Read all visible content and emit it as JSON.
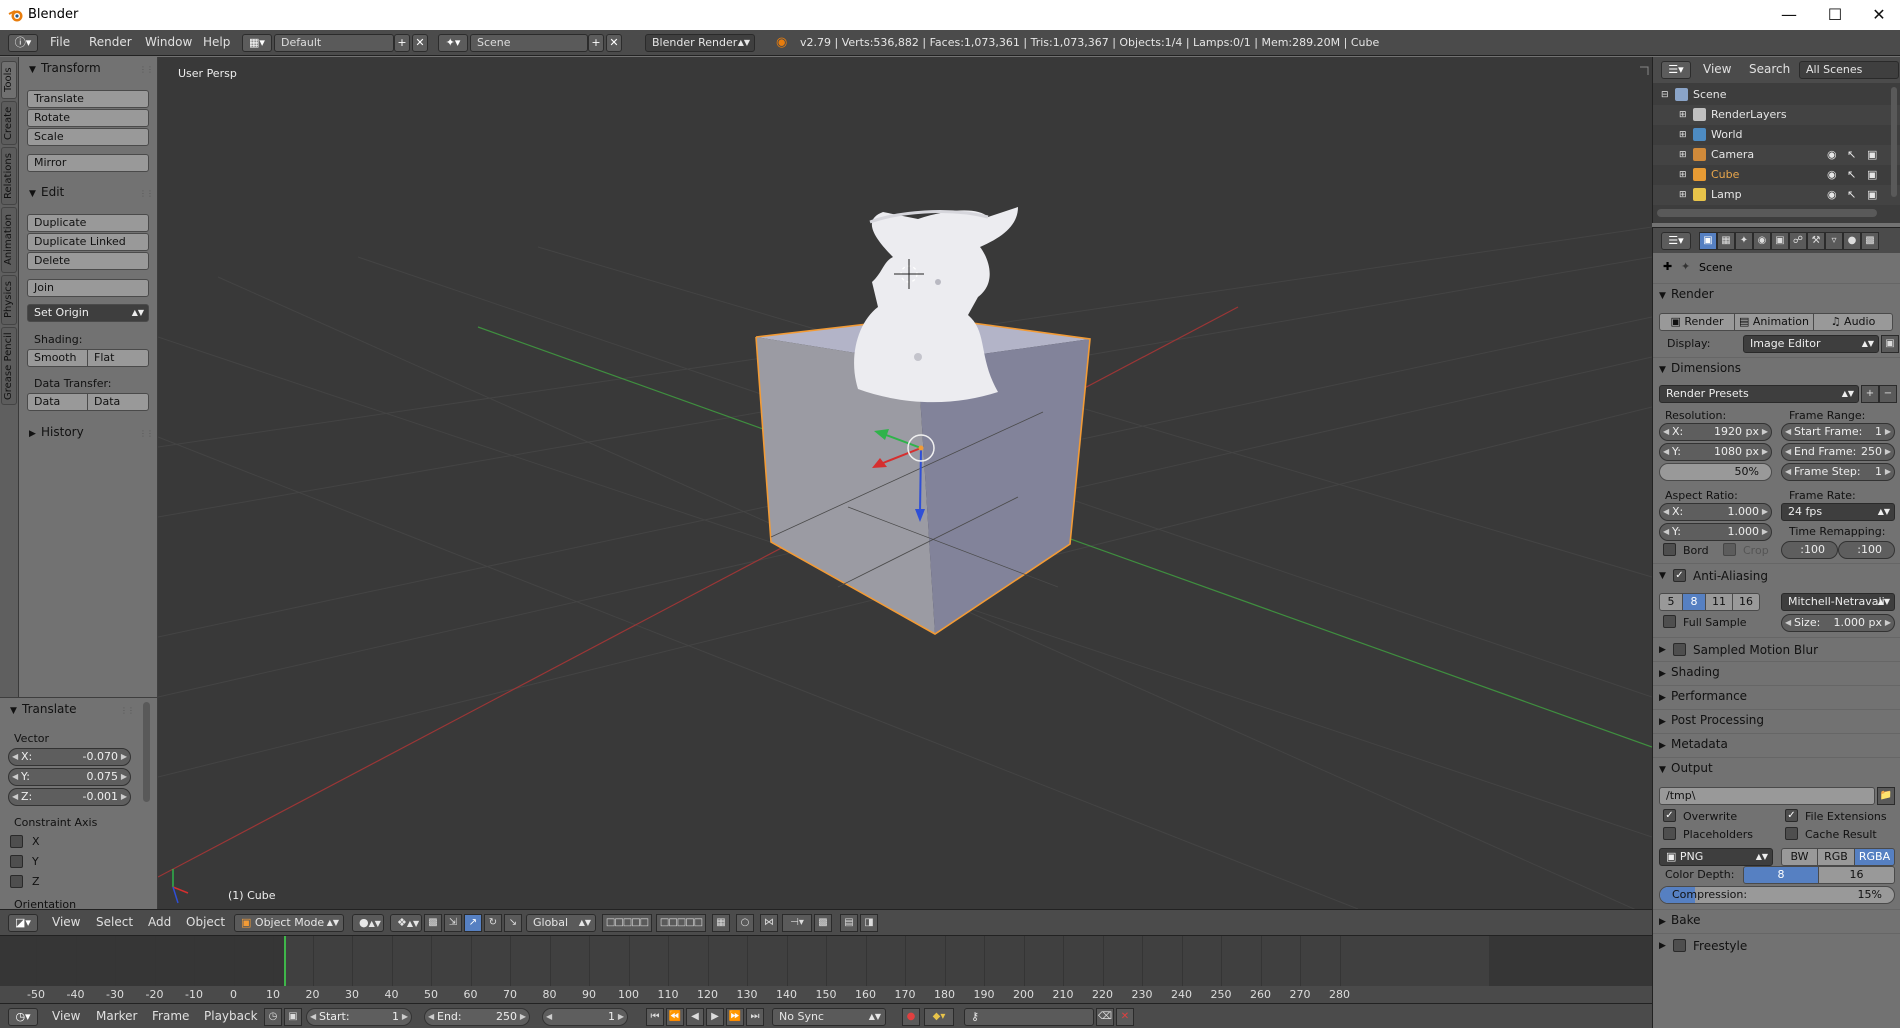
{
  "window": {
    "title": "Blender"
  },
  "info_header": {
    "menus": [
      "File",
      "Render",
      "Window",
      "Help"
    ],
    "screen_layout": "Default",
    "scene": "Scene",
    "render_engine": "Blender Render",
    "stats": "v2.79 | Verts:536,882 | Faces:1,073,361 | Tris:1,073,367 | Objects:1/4 | Lamps:0/1 | Mem:289.20M | Cube"
  },
  "tool_tabs": [
    "Tools",
    "Create",
    "Relations",
    "Animation",
    "Physics",
    "Grease Pencil"
  ],
  "toolshelf": {
    "transform": {
      "title": "Transform",
      "buttons": [
        "Translate",
        "Rotate",
        "Scale",
        "Mirror"
      ]
    },
    "edit": {
      "title": "Edit",
      "buttons": [
        "Duplicate",
        "Duplicate Linked",
        "Delete",
        "Join"
      ],
      "set_origin": "Set Origin",
      "shading_label": "Shading:",
      "smooth": "Smooth",
      "flat": "Flat",
      "data_transfer_label": "Data Transfer:",
      "data": "Data",
      "data_layout": "Data Layo"
    },
    "history": {
      "title": "History"
    }
  },
  "redo_panel": {
    "title": "Translate",
    "vector_label": "Vector",
    "x_label": "X:",
    "x": "-0.070",
    "y_label": "Y:",
    "y": "0.075",
    "z_label": "Z:",
    "z": "-0.001",
    "constraint_label": "Constraint Axis",
    "axes": [
      "X",
      "Y",
      "Z"
    ],
    "orientation_label": "Orientation"
  },
  "viewport": {
    "view_label": "User Persp",
    "object_label": "(1) Cube"
  },
  "view3d_header": {
    "menus": [
      "View",
      "Select",
      "Add",
      "Object"
    ],
    "mode": "Object Mode",
    "orientation": "Global"
  },
  "timeline": {
    "ticks": [
      "-50",
      "-40",
      "-30",
      "-20",
      "-10",
      "0",
      "10",
      "20",
      "30",
      "40",
      "50",
      "60",
      "70",
      "80",
      "90",
      "100",
      "110",
      "120",
      "130",
      "140",
      "150",
      "160",
      "170",
      "180",
      "190",
      "200",
      "210",
      "220",
      "230",
      "240",
      "250",
      "260",
      "270",
      "280"
    ],
    "current_frame": 1,
    "range_start": 1,
    "range_end": 250
  },
  "timeline_header": {
    "menus": [
      "View",
      "Marker",
      "Frame",
      "Playback"
    ],
    "start_label": "Start:",
    "start": "1",
    "end_label": "End:",
    "end": "250",
    "current": "1",
    "sync": "No Sync"
  },
  "outliner": {
    "header": {
      "view": "View",
      "search": "Search",
      "filter": "All Scenes"
    },
    "rows": [
      {
        "label": "Scene",
        "indent": 0,
        "color": "#8aa4c8"
      },
      {
        "label": "RenderLayers",
        "indent": 1,
        "color": "#c0c0c0"
      },
      {
        "label": "World",
        "indent": 1,
        "color": "#4d8bc2"
      },
      {
        "label": "Camera",
        "indent": 1,
        "color": "#d08a3a"
      },
      {
        "label": "Cube",
        "indent": 1,
        "color": "#e79b34"
      },
      {
        "label": "Lamp",
        "indent": 1,
        "color": "#e8c44a"
      }
    ],
    "selected_color": "#e8a64c"
  },
  "properties": {
    "context": "Scene",
    "render": {
      "title": "Render",
      "render_btn": "Render",
      "animation_btn": "Animation",
      "audio_btn": "Audio",
      "display_label": "Display:",
      "display": "Image Editor"
    },
    "dimensions": {
      "title": "Dimensions",
      "presets": "Render Presets",
      "resolution_label": "Resolution:",
      "res_x_label": "X:",
      "res_x": "1920 px",
      "res_y_label": "Y:",
      "res_y": "1080 px",
      "res_pct": "50%",
      "frame_range_label": "Frame Range:",
      "start_label": "Start Frame:",
      "start": "1",
      "end_label": "End Frame:",
      "end": "250",
      "step_label": "Frame Step:",
      "step": "1",
      "aspect_label": "Aspect Ratio:",
      "asp_x_label": "X:",
      "asp_x": "1.000",
      "asp_y_label": "Y:",
      "asp_y": "1.000",
      "frame_rate_label": "Frame Rate:",
      "frame_rate": "24 fps",
      "time_remap_label": "Time Remapping:",
      "remap_old": ":100",
      "remap_new": ":100",
      "bord": "Bord",
      "crop": "Crop"
    },
    "anti_aliasing": {
      "title": "Anti-Aliasing",
      "samples": [
        "5",
        "8",
        "11",
        "16"
      ],
      "selected": "8",
      "filter": "Mitchell-Netravali",
      "full_sample": "Full Sample",
      "size_label": "Size:",
      "size": "1.000 px"
    },
    "collapsed": [
      "Sampled Motion Blur",
      "Shading",
      "Performance",
      "Post Processing",
      "Metadata"
    ],
    "output": {
      "title": "Output",
      "path": "/tmp\\",
      "overwrite": "Overwrite",
      "file_ext": "File Extensions",
      "placeholders": "Placeholders",
      "cache": "Cache Result",
      "format": "PNG",
      "bw": "BW",
      "rgb": "RGB",
      "rgba": "RGBA",
      "color_depth_label": "Color Depth:",
      "depth_8": "8",
      "depth_16": "16",
      "compression_label": "Compression:",
      "compression": "15%",
      "compression_value": 0.15
    },
    "bottom": [
      "Bake",
      "Freestyle"
    ]
  },
  "colors": {
    "accent": "#5680c2",
    "selection_outline": "#f29b36",
    "grid_x": "#9b3636",
    "grid_y": "#3f8f3f",
    "timeline_cursor": "#3fb64a"
  }
}
